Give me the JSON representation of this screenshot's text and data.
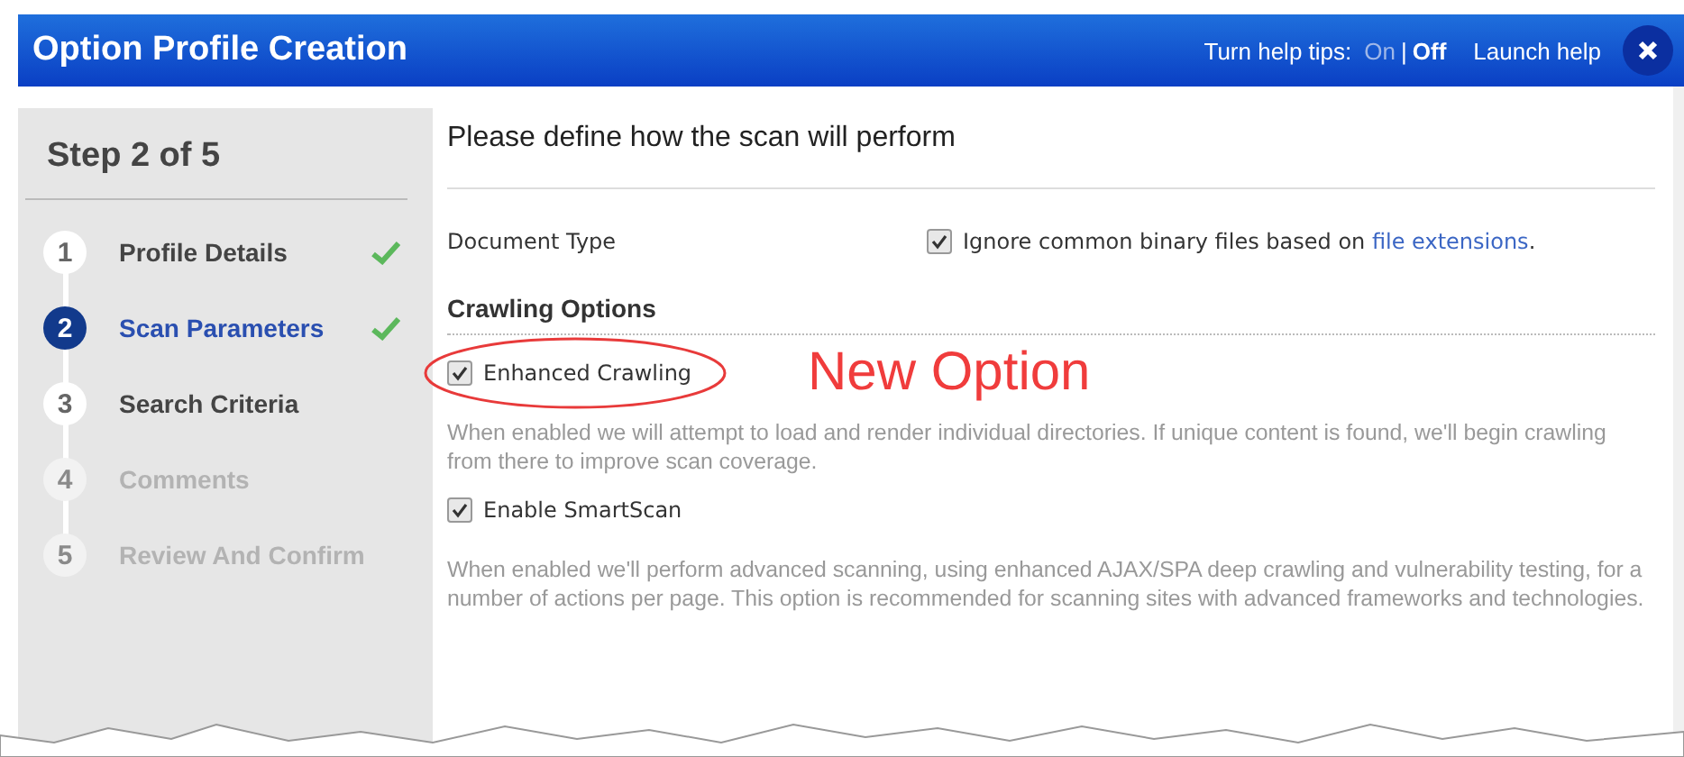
{
  "window": {
    "title": "Option Profile Creation"
  },
  "help_tips": {
    "label": "Turn help tips:",
    "options": [
      {
        "label": "On",
        "selected": false
      },
      {
        "label": "Off",
        "selected": true
      }
    ],
    "separator": "|"
  },
  "launch_help": "Launch help",
  "sidebar": {
    "title": "Step 2 of 5",
    "steps": [
      {
        "number": "1",
        "label": "Profile Details",
        "selected": false,
        "completed": true,
        "disabled": false
      },
      {
        "number": "2",
        "label": "Scan Parameters",
        "selected": true,
        "completed": true,
        "disabled": false
      },
      {
        "number": "3",
        "label": "Search Criteria",
        "selected": false,
        "completed": false,
        "disabled": false
      },
      {
        "number": "4",
        "label": "Comments",
        "selected": false,
        "completed": false,
        "disabled": true
      },
      {
        "number": "5",
        "label": "Review And Confirm",
        "selected": false,
        "completed": false,
        "disabled": true
      }
    ]
  },
  "main": {
    "heading": "Please define how the scan will perform",
    "document_type": {
      "label": "Document Type",
      "checked": true,
      "text": "Ignore common binary files based on",
      "link": "file extensions",
      "suffix": "."
    },
    "section_title": "Crawling Options",
    "options": [
      {
        "label": "Enhanced Crawling",
        "checked": true,
        "highlighted": true,
        "description": "When enabled we will attempt to load and render individual directories. If unique content is found, we'll begin crawling from there to improve scan coverage."
      },
      {
        "label": "Enable SmartScan",
        "checked": true,
        "highlighted": false,
        "description": "When enabled we'll perform advanced scanning, using enhanced AJAX/SPA deep crawling and vulnerability testing, for a number of actions per page. This option is recommended for scanning sites with advanced frameworks and technologies."
      }
    ],
    "callout": "New Option"
  }
}
